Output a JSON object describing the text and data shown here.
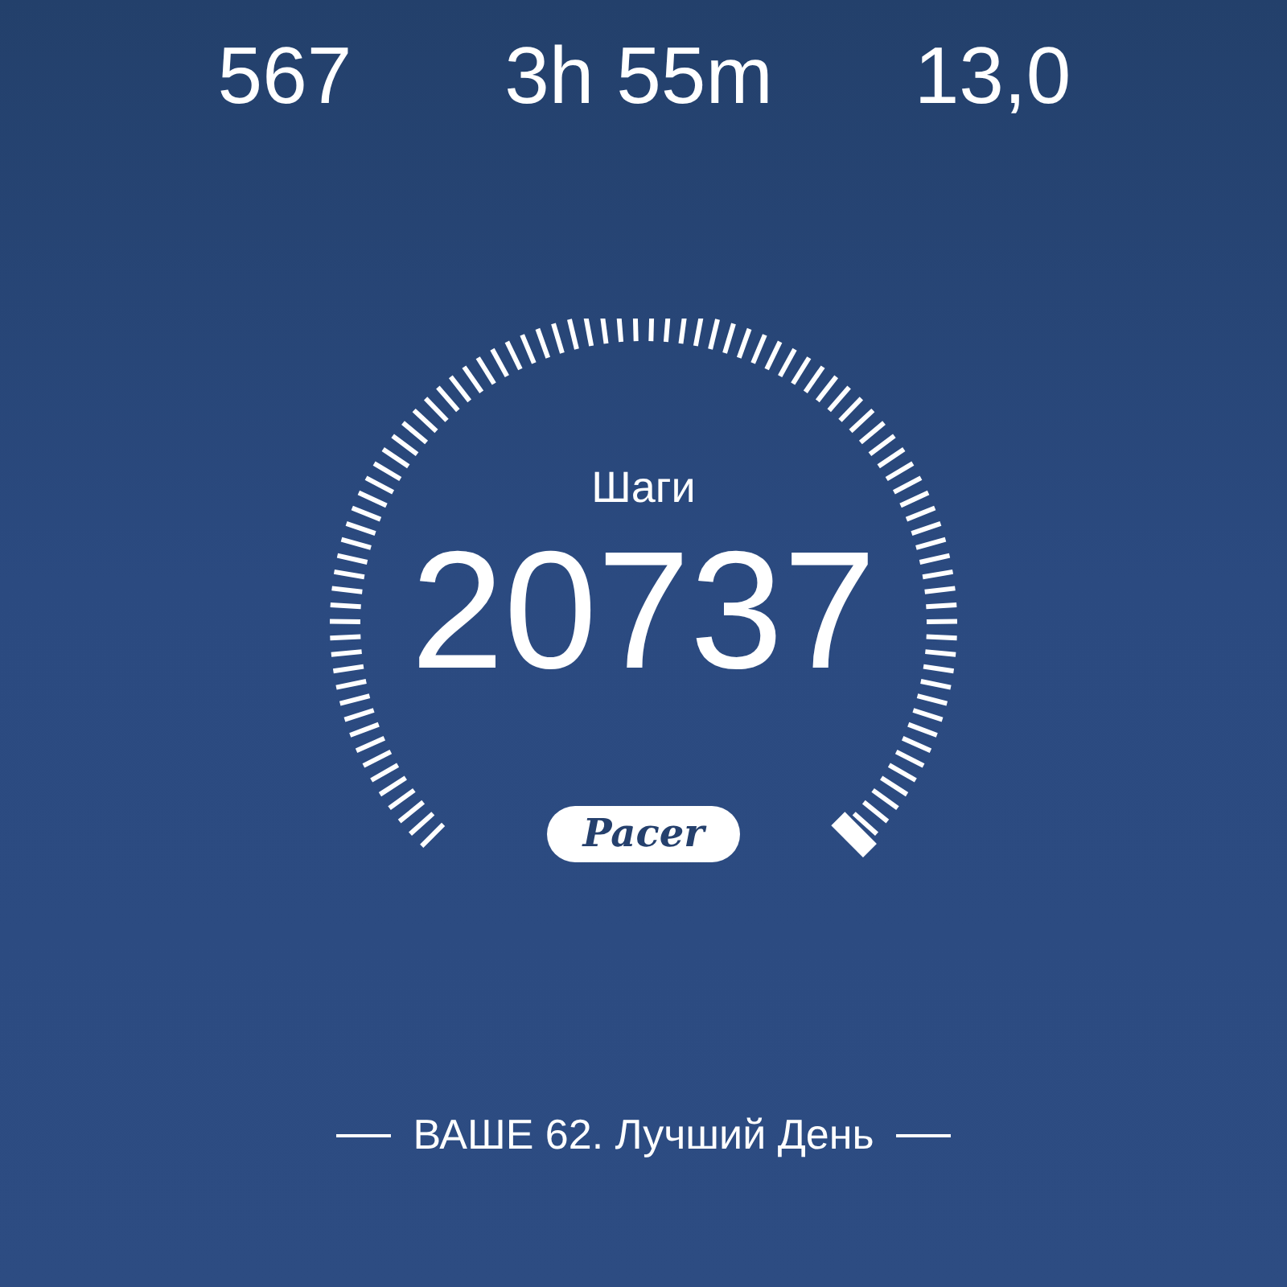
{
  "stats": [
    {
      "value": "567"
    },
    {
      "value": "3h 55m"
    },
    {
      "value": "13,0"
    }
  ],
  "steps": {
    "label": "Шаги",
    "value": "20737"
  },
  "logo": "Pacer",
  "footer": "ВАШЕ 62. Лучший День"
}
